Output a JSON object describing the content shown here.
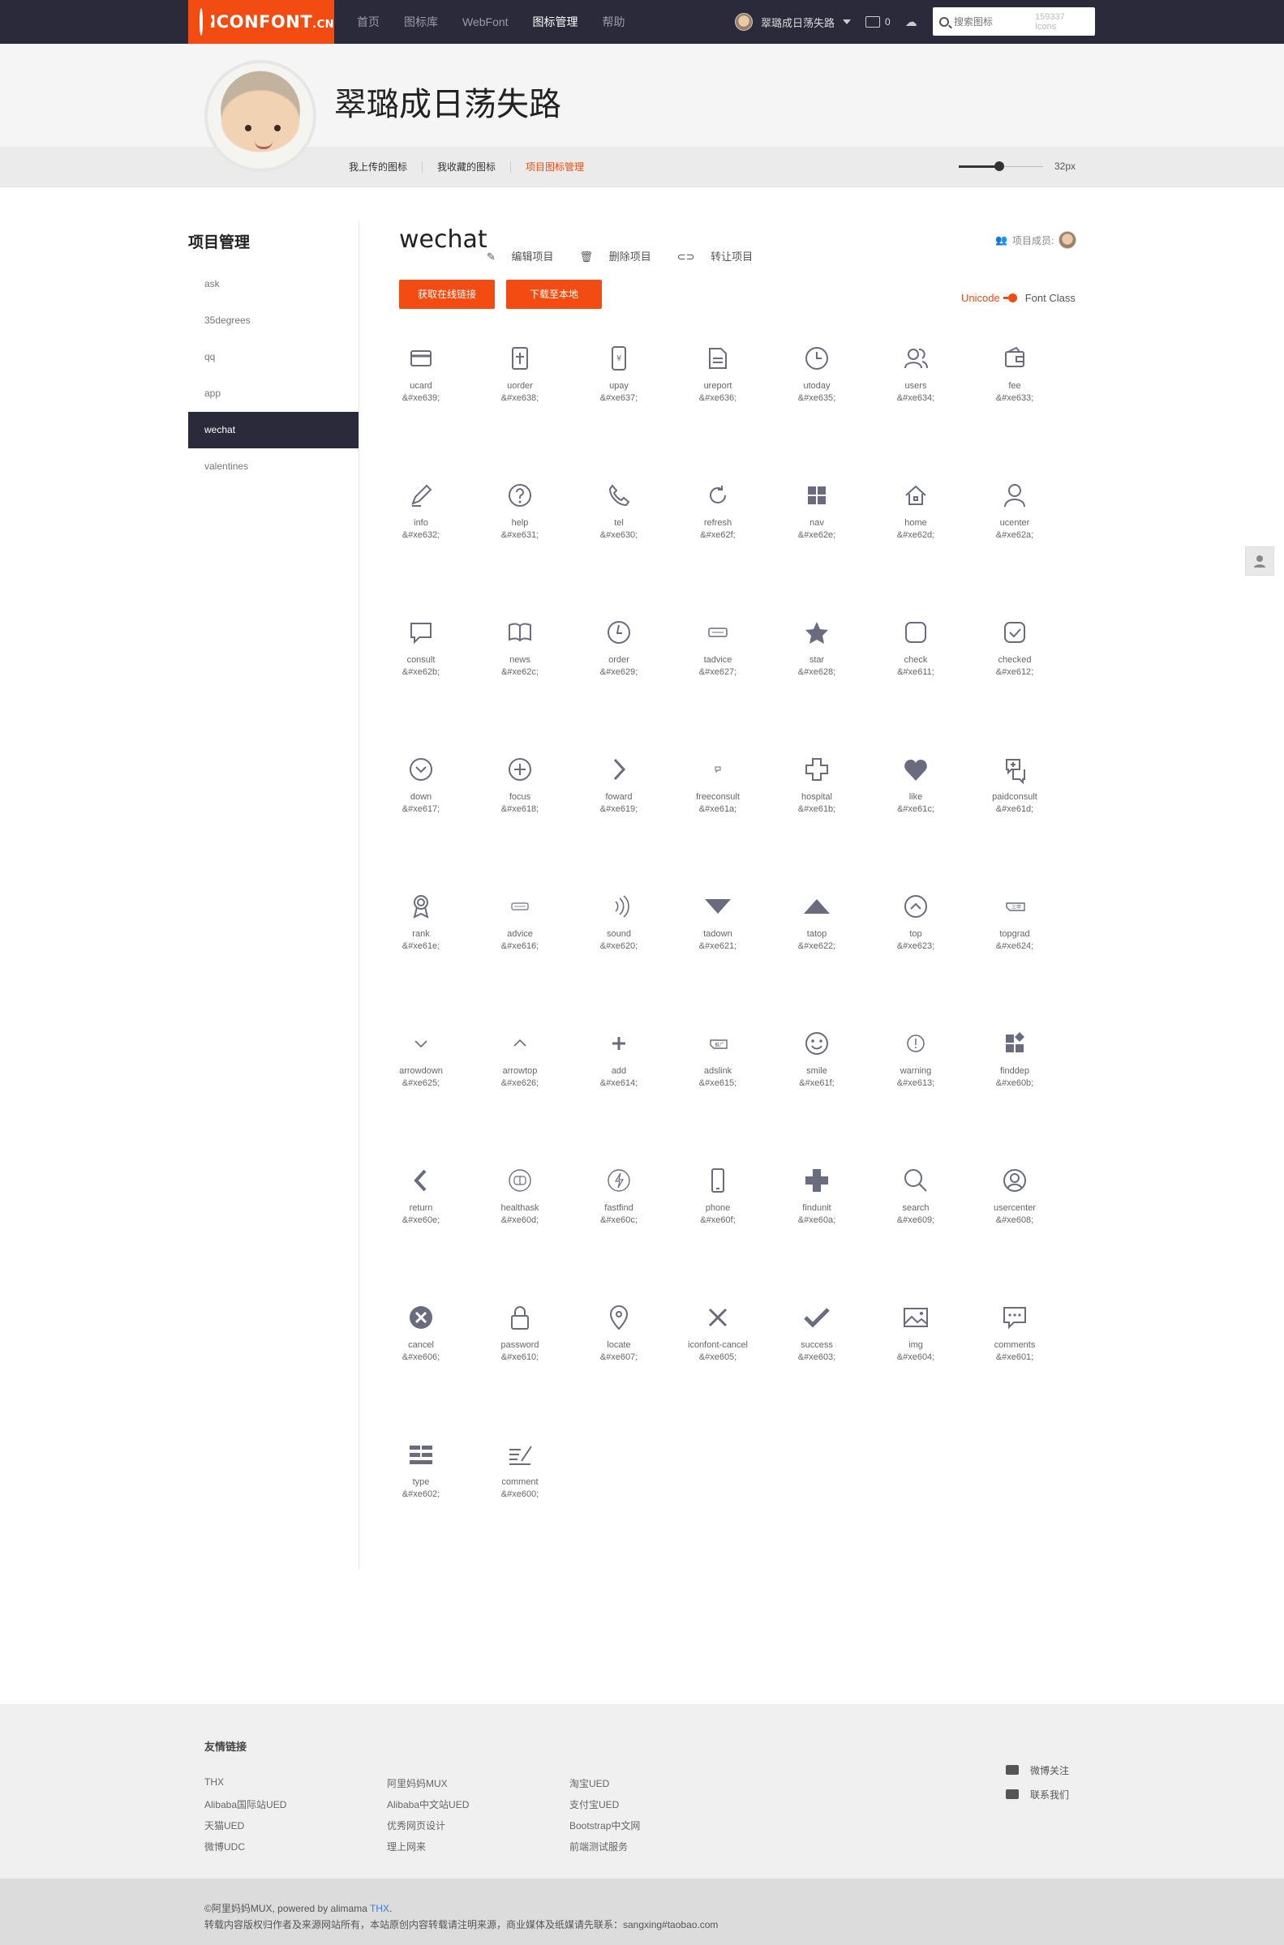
{
  "header": {
    "logo_text": "ICONFONT",
    "logo_suffix": ".CN",
    "nav": [
      "首页",
      "图标库",
      "WebFont",
      "图标管理",
      "帮助"
    ],
    "nav_active": 3,
    "username": "翠璐成日荡失路",
    "cart_count": "0",
    "search_placeholder": "搜索图标",
    "search_count": "159337 Icons"
  },
  "profile": {
    "name": "翠璐成日荡失路",
    "tabs": [
      "我上传的图标",
      "我收藏的图标",
      "项目图标管理"
    ],
    "size_label": "32px"
  },
  "sidebar": {
    "title": "项目管理",
    "items": [
      "ask",
      "35degrees",
      "qq",
      "app",
      "wechat",
      "valentines"
    ],
    "active": 4
  },
  "project": {
    "title": "wechat",
    "actions": [
      "编辑项目",
      "删除项目",
      "转让项目"
    ],
    "btn_online": "获取在线链接",
    "btn_download": "下载至本地",
    "members_label": "项目成员:",
    "toggle_on": "Unicode",
    "toggle_off": "Font Class"
  },
  "icons": [
    {
      "name": "ucard",
      "code": "&#xe639;",
      "icon": "card"
    },
    {
      "name": "uorder",
      "code": "&#xe638;",
      "icon": "doc"
    },
    {
      "name": "upay",
      "code": "&#xe637;",
      "icon": "mobile-yen"
    },
    {
      "name": "ureport",
      "code": "&#xe636;",
      "icon": "report"
    },
    {
      "name": "utoday",
      "code": "&#xe635;",
      "icon": "clock"
    },
    {
      "name": "users",
      "code": "&#xe634;",
      "icon": "users"
    },
    {
      "name": "fee",
      "code": "&#xe633;",
      "icon": "wallet"
    },
    {
      "name": "info",
      "code": "&#xe632;",
      "icon": "pencil"
    },
    {
      "name": "help",
      "code": "&#xe631;",
      "icon": "question"
    },
    {
      "name": "tel",
      "code": "&#xe630;",
      "icon": "phone-handset"
    },
    {
      "name": "refresh",
      "code": "&#xe62f;",
      "icon": "refresh"
    },
    {
      "name": "nav",
      "code": "&#xe62e;",
      "icon": "grid"
    },
    {
      "name": "home",
      "code": "&#xe62d;",
      "icon": "house"
    },
    {
      "name": "ucenter",
      "code": "&#xe62a;",
      "icon": "user"
    },
    {
      "name": "consult",
      "code": "&#xe62b;",
      "icon": "bubble"
    },
    {
      "name": "news",
      "code": "&#xe62c;",
      "icon": "book"
    },
    {
      "name": "order",
      "code": "&#xe629;",
      "icon": "clock2"
    },
    {
      "name": "tadvice",
      "code": "&#xe627;",
      "icon": "tag"
    },
    {
      "name": "star",
      "code": "&#xe628;",
      "icon": "star"
    },
    {
      "name": "check",
      "code": "&#xe611;",
      "icon": "box"
    },
    {
      "name": "checked",
      "code": "&#xe612;",
      "icon": "box-check"
    },
    {
      "name": "down",
      "code": "&#xe617;",
      "icon": "circle-down"
    },
    {
      "name": "focus",
      "code": "&#xe618;",
      "icon": "circle-plus"
    },
    {
      "name": "foward",
      "code": "&#xe619;",
      "icon": "chevron-right"
    },
    {
      "name": "freeconsult",
      "code": "&#xe61a;",
      "icon": "tiny-bubble"
    },
    {
      "name": "hospital",
      "code": "&#xe61b;",
      "icon": "cross-outline"
    },
    {
      "name": "like",
      "code": "&#xe61c;",
      "icon": "heart"
    },
    {
      "name": "paidconsult",
      "code": "&#xe61d;",
      "icon": "paid-bubble"
    },
    {
      "name": "rank",
      "code": "&#xe61e;",
      "icon": "medal"
    },
    {
      "name": "advice",
      "code": "&#xe616;",
      "icon": "tag-small"
    },
    {
      "name": "sound",
      "code": "&#xe620;",
      "icon": "sound"
    },
    {
      "name": "tadown",
      "code": "&#xe621;",
      "icon": "tri-down"
    },
    {
      "name": "tatop",
      "code": "&#xe622;",
      "icon": "tri-up"
    },
    {
      "name": "top",
      "code": "&#xe623;",
      "icon": "circle-up"
    },
    {
      "name": "topgrad",
      "code": "&#xe624;",
      "icon": "tag-three"
    },
    {
      "name": "arrowdown",
      "code": "&#xe625;",
      "icon": "chev-down"
    },
    {
      "name": "arrowtop",
      "code": "&#xe626;",
      "icon": "chev-up"
    },
    {
      "name": "add",
      "code": "&#xe614;",
      "icon": "plus"
    },
    {
      "name": "adslink",
      "code": "&#xe615;",
      "icon": "tag-ad"
    },
    {
      "name": "smile",
      "code": "&#xe61f;",
      "icon": "smile"
    },
    {
      "name": "warning",
      "code": "&#xe613;",
      "icon": "warning"
    },
    {
      "name": "finddep",
      "code": "&#xe60b;",
      "icon": "finddep"
    },
    {
      "name": "return",
      "code": "&#xe60e;",
      "icon": "chevron-left"
    },
    {
      "name": "healthask",
      "code": "&#xe60d;",
      "icon": "health"
    },
    {
      "name": "fastfind",
      "code": "&#xe60c;",
      "icon": "bolt"
    },
    {
      "name": "phone",
      "code": "&#xe60f;",
      "icon": "mobile"
    },
    {
      "name": "findunit",
      "code": "&#xe60a;",
      "icon": "cross-solid"
    },
    {
      "name": "search",
      "code": "&#xe609;",
      "icon": "magnifier"
    },
    {
      "name": "usercenter",
      "code": "&#xe608;",
      "icon": "user-circle"
    },
    {
      "name": "cancel",
      "code": "&#xe606;",
      "icon": "x-circle"
    },
    {
      "name": "password",
      "code": "&#xe610;",
      "icon": "lock"
    },
    {
      "name": "locate",
      "code": "&#xe607;",
      "icon": "pin"
    },
    {
      "name": "iconfont-cancel",
      "code": "&#xe605;",
      "icon": "x"
    },
    {
      "name": "success",
      "code": "&#xe603;",
      "icon": "check"
    },
    {
      "name": "img",
      "code": "&#xe604;",
      "icon": "image"
    },
    {
      "name": "comments",
      "code": "&#xe601;",
      "icon": "comments"
    },
    {
      "name": "type",
      "code": "&#xe602;",
      "icon": "list-type"
    },
    {
      "name": "comment",
      "code": "&#xe600;",
      "icon": "write"
    }
  ],
  "footer": {
    "title": "友情链接",
    "links": [
      [
        "THX",
        "Alibaba国际站UED",
        "天猫UED",
        "微博UDC"
      ],
      [
        "阿里妈妈MUX",
        "Alibaba中文站UED",
        "优秀网页设计",
        "理上网来"
      ],
      [
        "淘宝UED",
        "支付宝UED",
        "Bootstrap中文网",
        "前端测试服务"
      ]
    ],
    "social": [
      "微博关注",
      "联系我们"
    ],
    "copyright": "©阿里妈妈MUX, powered by alimama ",
    "copyright_link": "THX",
    "copyright_end": ".",
    "notice": "转载内容版权归作者及来源网站所有，本站原创内容转载请注明来源，商业媒体及纸媒请先联系：sangxing#taobao.com"
  },
  "colors": {
    "accent": "#f34c12",
    "header": "#2a2a3a",
    "icon": "#6b6b80"
  }
}
